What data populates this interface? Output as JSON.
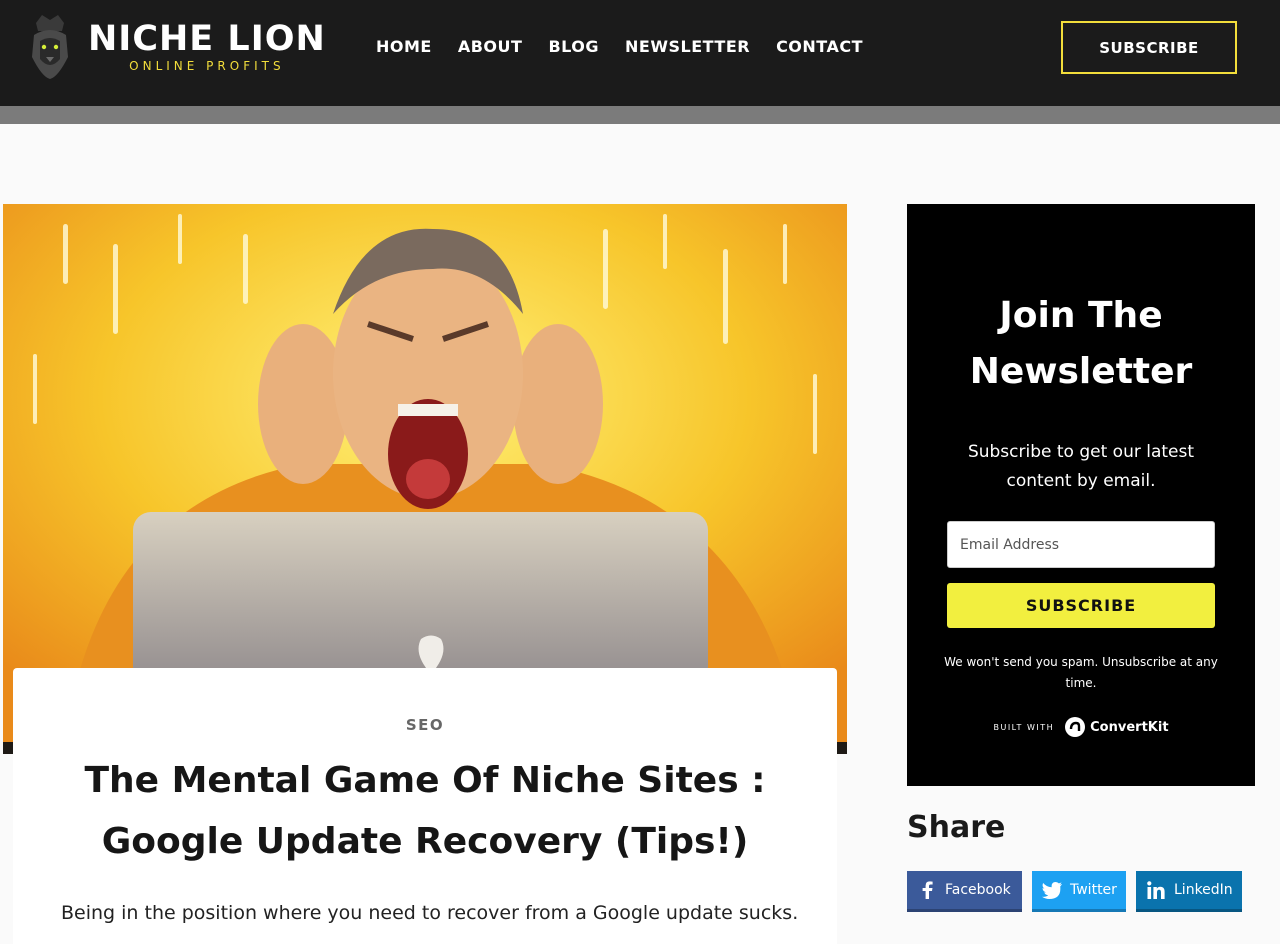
{
  "header": {
    "logo_title": "NICHE LION",
    "logo_subtitle": "ONLINE PROFITS",
    "nav": [
      "HOME",
      "ABOUT",
      "BLOG",
      "NEWSLETTER",
      "CONTACT"
    ],
    "subscribe_label": "SUBSCRIBE"
  },
  "article": {
    "category": "SEO",
    "title": "The Mental Game Of Niche Sites : Google Update Recovery (Tips!)",
    "intro": "Being in the position where you need to recover from a Google update sucks."
  },
  "newsletter": {
    "title": "Join The Newsletter",
    "description": "Subscribe to get our latest content by email.",
    "email_placeholder": "Email Address",
    "button_label": "SUBSCRIBE",
    "note": "We won't send you spam. Unsubscribe at any time.",
    "built_with": "BUILT WITH",
    "provider": "ConvertKit"
  },
  "share": {
    "title": "Share",
    "facebook": "Facebook",
    "twitter": "Twitter",
    "linkedin": "LinkedIn"
  },
  "colors": {
    "header_bg": "#1b1b1b",
    "accent_yellow": "#f2dd3b",
    "newsletter_bg": "#000000",
    "newsletter_button": "#f2ef3f",
    "facebook": "#3b5a9a",
    "twitter": "#1da1f2",
    "linkedin": "#0a73ad"
  },
  "icons": [
    "lion-logo-icon",
    "convertkit-icon",
    "facebook-icon",
    "twitter-icon",
    "linkedin-icon"
  ]
}
